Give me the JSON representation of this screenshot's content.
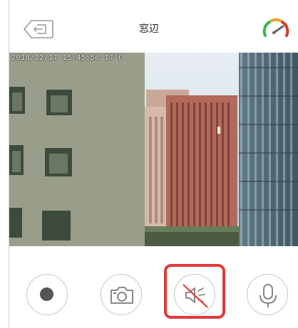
{
  "header": {
    "title": "窓辺",
    "back_icon": "back-exit-icon",
    "status_icon": "signal-gauge-icon"
  },
  "video": {
    "timestamp": "2018/12/17 15:45:56 17°C"
  },
  "controls": {
    "items": [
      {
        "name": "record",
        "icon": "record-icon"
      },
      {
        "name": "snapshot",
        "icon": "camera-icon"
      },
      {
        "name": "speaker-mute",
        "icon": "speaker-muted-icon",
        "highlighted": true
      },
      {
        "name": "microphone",
        "icon": "microphone-icon"
      }
    ]
  },
  "colors": {
    "highlight": "#e03a3a",
    "gauge_green": "#3cb44b",
    "gauge_orange": "#f0a030",
    "gauge_red": "#d83a2a",
    "icon_gray": "#7a7a7a"
  }
}
